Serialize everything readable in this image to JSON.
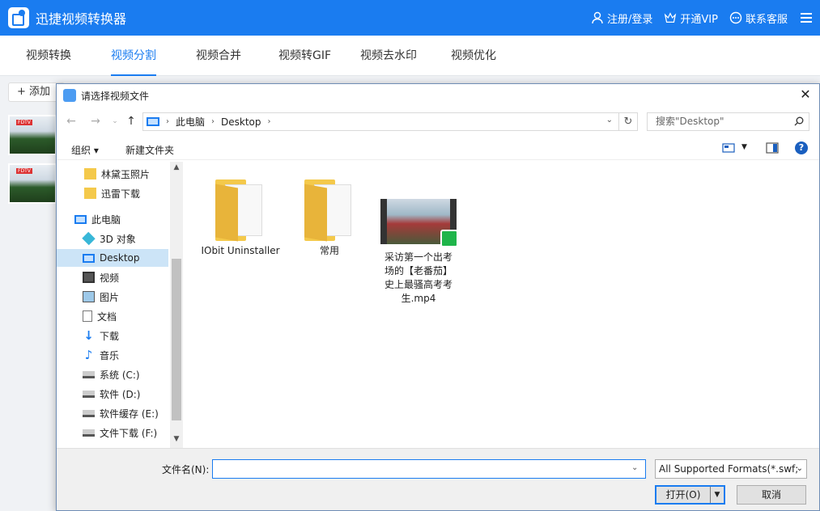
{
  "app": {
    "title": "迅捷视频转换器",
    "actions": {
      "login": "注册/登录",
      "vip": "开通VIP",
      "support": "联系客服"
    }
  },
  "tabs": [
    {
      "label": "视频转换"
    },
    {
      "label": "视频分割",
      "active": true
    },
    {
      "label": "视频合并"
    },
    {
      "label": "视频转GIF"
    },
    {
      "label": "视频去水印"
    },
    {
      "label": "视频优化"
    }
  ],
  "background": {
    "add_label": "+ 添加",
    "thumb_tag": "FDTV"
  },
  "dialog": {
    "title": "请选择视频文件",
    "breadcrumb": [
      "此电脑",
      "Desktop"
    ],
    "search_placeholder": "搜索\"Desktop\"",
    "toolbar": {
      "organize": "组织 ▾",
      "new_folder": "新建文件夹",
      "help": "?"
    },
    "nav_items": [
      {
        "label": "林黛玉照片",
        "icon": "folder-icon"
      },
      {
        "label": "迅雷下载",
        "icon": "folder-icon"
      },
      {
        "label": "此电脑",
        "icon": "computer-icon"
      },
      {
        "label": "3D 对象",
        "icon": "cube-icon"
      },
      {
        "label": "Desktop",
        "icon": "desktop-icon",
        "selected": true
      },
      {
        "label": "视频",
        "icon": "video-icon"
      },
      {
        "label": "图片",
        "icon": "picture-icon"
      },
      {
        "label": "文档",
        "icon": "document-icon"
      },
      {
        "label": "下载",
        "icon": "download-icon"
      },
      {
        "label": "音乐",
        "icon": "music-icon"
      },
      {
        "label": "系统 (C:)",
        "icon": "drive-icon"
      },
      {
        "label": "软件 (D:)",
        "icon": "drive-icon"
      },
      {
        "label": "软件缓存 (E:)",
        "icon": "drive-icon"
      },
      {
        "label": "文件下载 (F:)",
        "icon": "drive-icon"
      }
    ],
    "files": [
      {
        "name": "IObit Uninstaller",
        "type": "folder"
      },
      {
        "name": "常用",
        "type": "folder"
      },
      {
        "name": "采访第一个出考场的【老番茄】史上最骚高考考生.mp4",
        "type": "video"
      }
    ],
    "filename_label": "文件名(N):",
    "filename_value": "",
    "filetype": "All Supported Formats(*.swf;",
    "open_label": "打开(O)",
    "cancel_label": "取消"
  },
  "colors": {
    "accent": "#1a7cf0",
    "selection": "#cce4f7",
    "folder": "#f4c94b"
  }
}
